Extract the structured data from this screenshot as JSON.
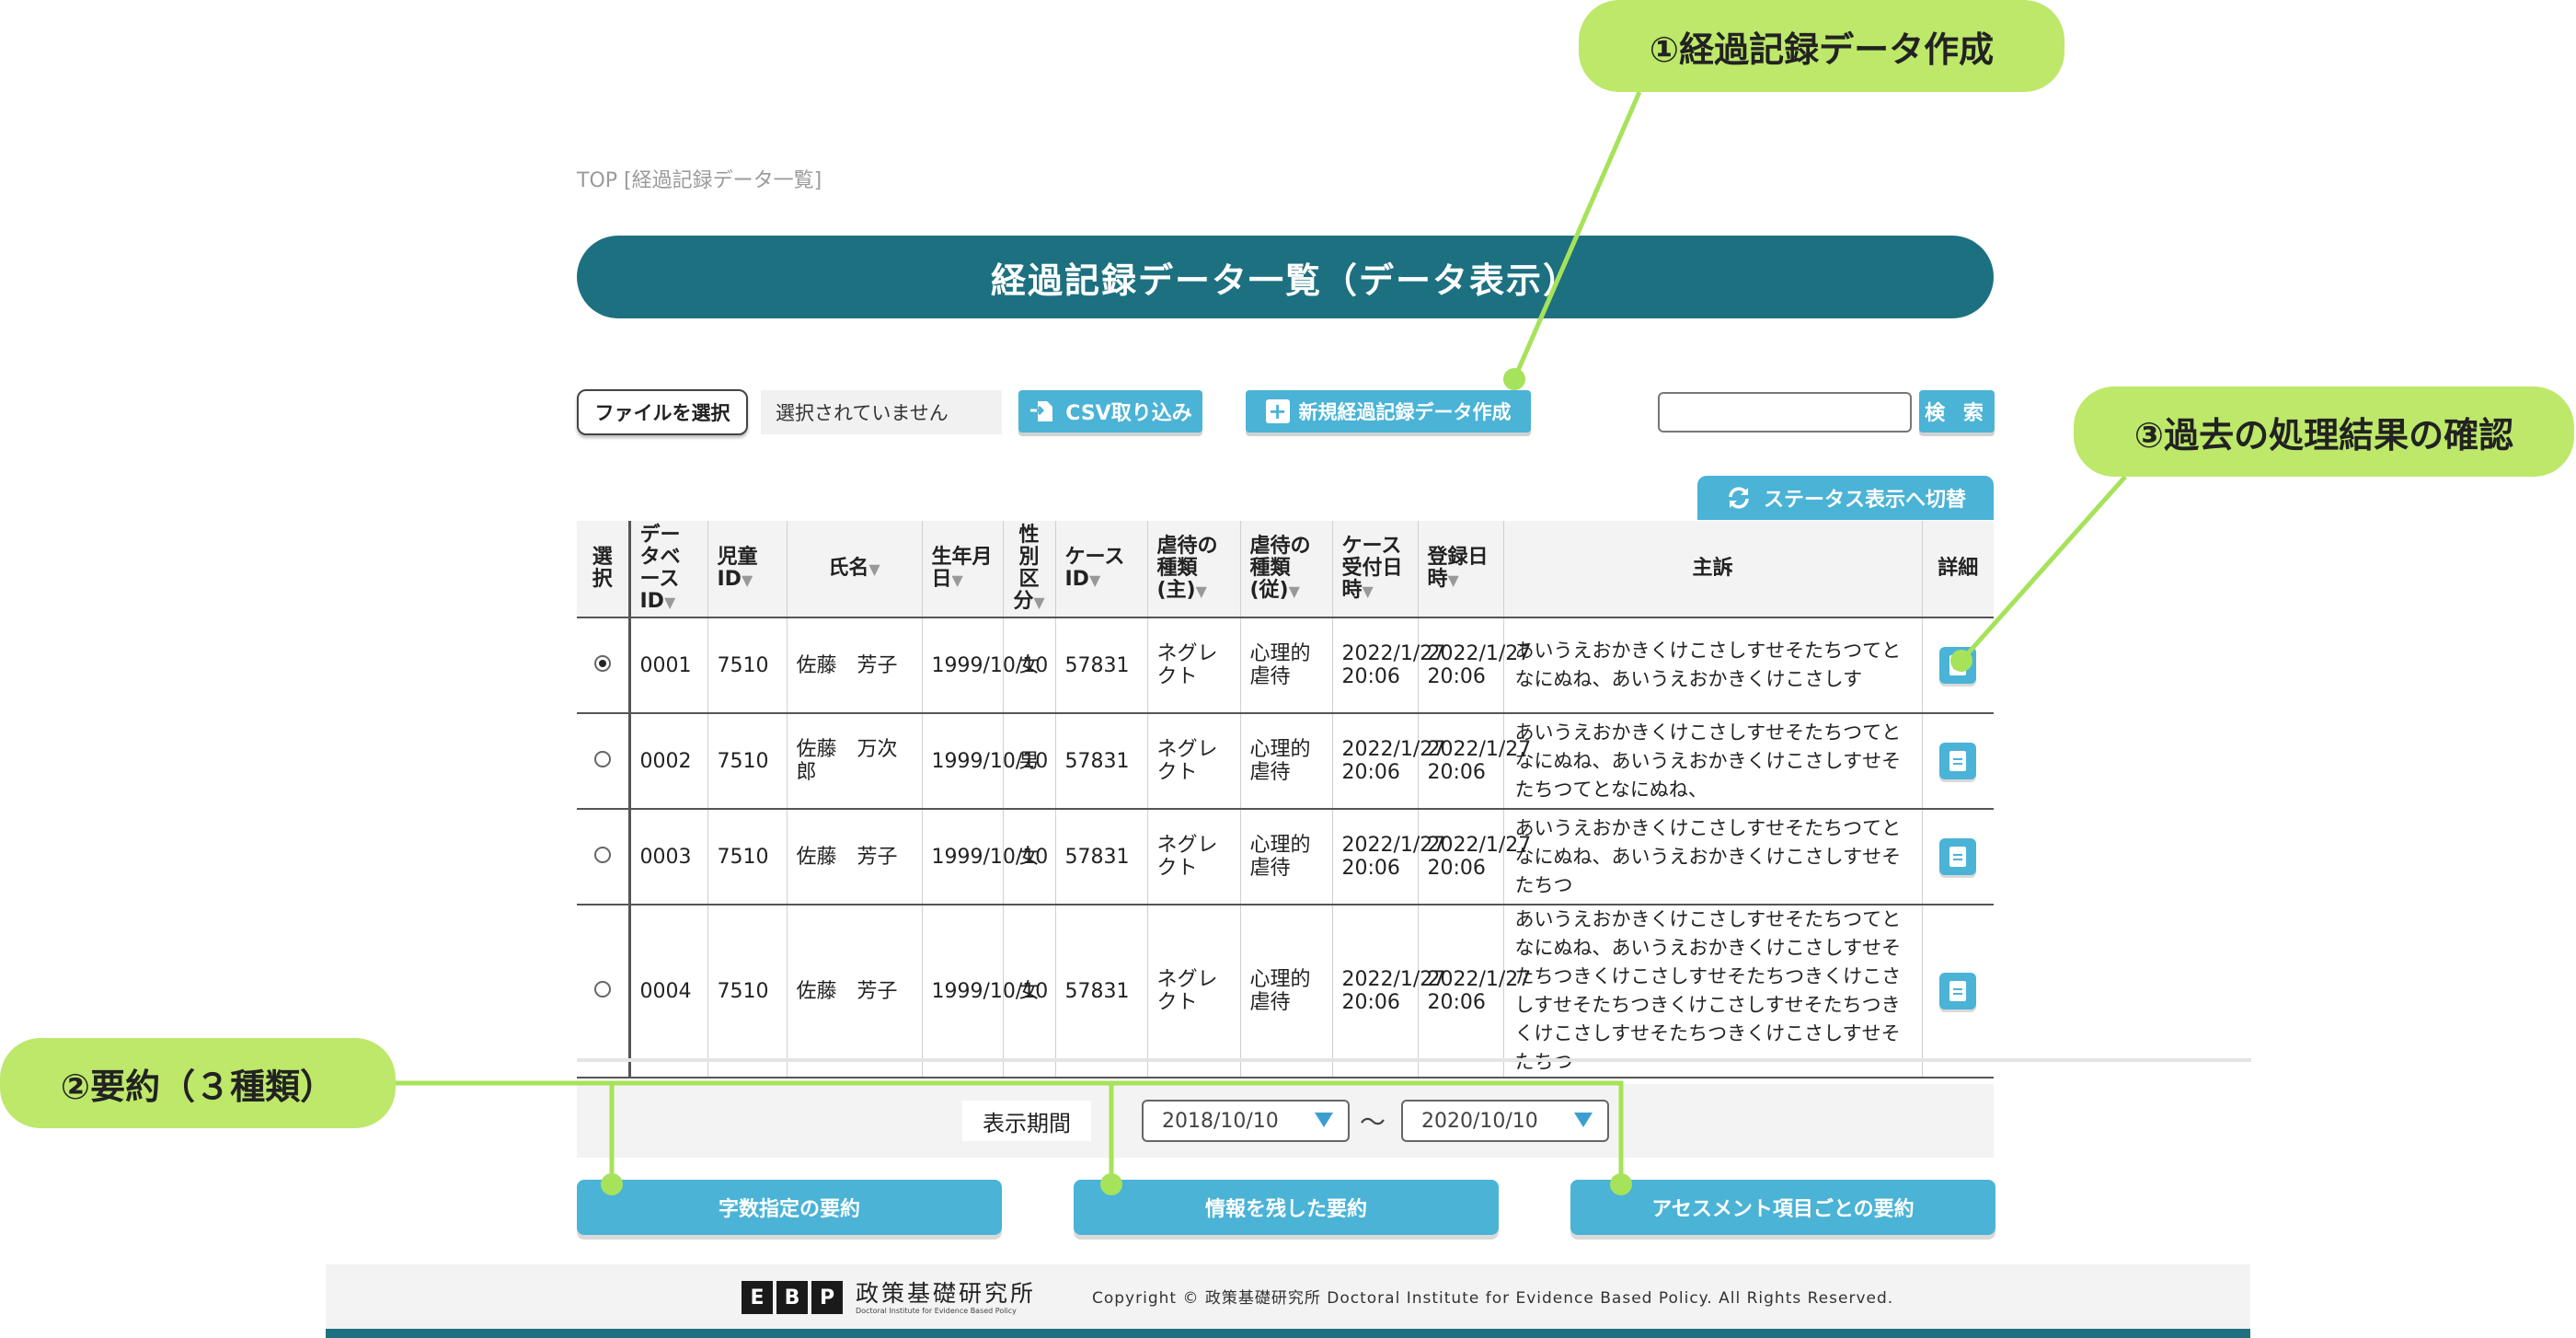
{
  "breadcrumb": "TOP [経過記録データ一覧]",
  "page_title": "経過記録データ一覧（データ表示）",
  "toolbar": {
    "file_select_label": "ファイルを選択",
    "file_status": "選択されていません",
    "csv_import_label": "CSV取り込み",
    "new_record_label": "新規経過記録データ作成",
    "search_value": "",
    "search_label": "検 索",
    "status_toggle_label": "ステータス表示へ切替"
  },
  "table": {
    "headers": {
      "select": "選択",
      "db_id": "データベースID",
      "child_id": "児童ID",
      "name": "氏名",
      "birth": "生年月日",
      "sex": "性別区分",
      "case_id": "ケースID",
      "abuse_main": "虐待の種類(主)",
      "abuse_sub": "虐待の種類(従)",
      "case_date": "ケース受付日時",
      "reg_date": "登録日時",
      "complaint": "主訴",
      "detail": "詳細"
    },
    "rows": [
      {
        "selected": true,
        "db_id": "0001",
        "child_id": "7510",
        "name": "佐藤　芳子",
        "birth": "1999/10/10",
        "sex": "女",
        "case_id": "57831",
        "abuse_main": "ネグレクト",
        "abuse_sub": "心理的虐待",
        "case_date": "2022/1/27 20:06",
        "reg_date": "2022/1/27 20:06",
        "complaint": "あいうえおかきくけこさしすせそたちつてとなにぬね、あいうえおかきくけこさしす"
      },
      {
        "selected": false,
        "db_id": "0002",
        "child_id": "7510",
        "name": "佐藤　万次郎",
        "birth": "1999/10/10",
        "sex": "男",
        "case_id": "57831",
        "abuse_main": "ネグレクト",
        "abuse_sub": "心理的虐待",
        "case_date": "2022/1/27 20:06",
        "reg_date": "2022/1/27 20:06",
        "complaint": "あいうえおかきくけこさしすせそたちつてとなにぬね、あいうえおかきくけこさしすせそたちつてとなにぬね、"
      },
      {
        "selected": false,
        "db_id": "0003",
        "child_id": "7510",
        "name": "佐藤　芳子",
        "birth": "1999/10/10",
        "sex": "女",
        "case_id": "57831",
        "abuse_main": "ネグレクト",
        "abuse_sub": "心理的虐待",
        "case_date": "2022/1/27 20:06",
        "reg_date": "2022/1/27 20:06",
        "complaint": "あいうえおかきくけこさしすせそたちつてとなにぬね、あいうえおかきくけこさしすせそたちつ"
      },
      {
        "selected": false,
        "db_id": "0004",
        "child_id": "7510",
        "name": "佐藤　芳子",
        "birth": "1999/10/10",
        "sex": "女",
        "case_id": "57831",
        "abuse_main": "ネグレクト",
        "abuse_sub": "心理的虐待",
        "case_date": "2022/1/27 20:06",
        "reg_date": "2022/1/27 20:06",
        "complaint": "あいうえおかきくけこさしすせそたちつてとなにぬね、あいうえおかきくけこさしすせそたちつきくけこさしすせそたちつきくけこさしすせそたちつきくけこさしすせそたちつきくけこさしすせそたちつきくけこさしすせそたちつ"
      }
    ]
  },
  "period": {
    "label": "表示期間",
    "from": "2018/10/10",
    "separator": "〜",
    "to": "2020/10/10"
  },
  "summary_buttons": {
    "char_limit": "字数指定の要約",
    "info_keep": "情報を残した要約",
    "per_item": "アセスメント項目ごとの要約"
  },
  "footer": {
    "logo_letters": [
      "E",
      "B",
      "P"
    ],
    "logo_name": "政策基礎研究所",
    "logo_sub": "Doctoral Institute for Evidence Based Policy",
    "copyright": "Copyright © 政策基礎研究所 Doctoral Institute for Evidence Based Policy. All Rights Reserved."
  },
  "callouts": {
    "c1": "①経過記録データ作成",
    "c2": "②要約（３種類）",
    "c3": "③過去の処理結果の確認"
  },
  "colors": {
    "teal": "#1d7080",
    "button_blue": "#4ab3d6",
    "callout_green": "#bde86a",
    "callout_line": "#a6e25a"
  }
}
